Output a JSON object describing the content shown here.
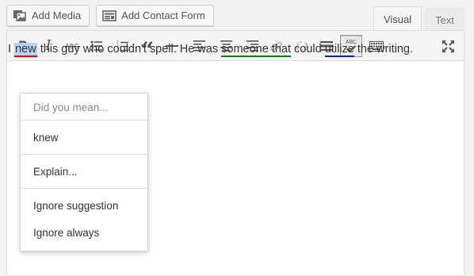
{
  "media_buttons": {
    "add_media": "Add Media",
    "add_contact_form": "Add Contact Form"
  },
  "tabs": {
    "visual": "Visual",
    "text": "Text",
    "active": "Visual"
  },
  "toolbar": {
    "items": [
      "bold",
      "italic",
      "strikethrough",
      "bulleted-list",
      "numbered-list",
      "blockquote",
      "horizontal-rule",
      "align-left",
      "align-center",
      "align-right",
      "insert-link",
      "remove-link",
      "read-more",
      "proofread",
      "toolbar-toggle",
      "fullscreen"
    ],
    "bold_glyph": "B",
    "italic_glyph": "I",
    "strike_glyph": "ABC",
    "quote_glyph": "“",
    "proofread_glyph": "ABC",
    "proofread_active": true
  },
  "content": {
    "t1": "I ",
    "misspelled": "new",
    "t2": " this guy who couldn't spell. He was ",
    "grammar": "someone that",
    "t3": " could ",
    "style": "utilize",
    "t4": " the writing."
  },
  "context_menu": {
    "header": "Did you mean...",
    "suggestion": "knew",
    "explain": "Explain...",
    "ignore_suggestion": "Ignore suggestion",
    "ignore_always": "Ignore always"
  },
  "colors": {
    "spelling_underline": "#dd0000",
    "grammar_underline": "#0a7e07",
    "style_underline": "#0020c2",
    "selection": "#b8d3f2"
  }
}
